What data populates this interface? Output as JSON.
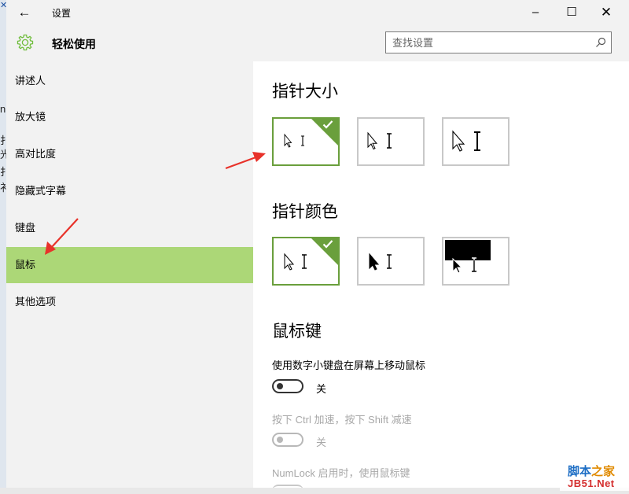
{
  "titlebar": {
    "back_icon": "arrow-left-icon",
    "title": "设置",
    "minimize_symbol": "–",
    "maximize_symbol": "☐",
    "close_symbol": "✕"
  },
  "header": {
    "icon": "gear-icon",
    "title": "轻松使用",
    "search_placeholder": "查找设置",
    "accent_color": "#6fbd3c"
  },
  "sidebar": {
    "items": [
      {
        "label": "讲述人"
      },
      {
        "label": "放大镜"
      },
      {
        "label": "高对比度"
      },
      {
        "label": "隐藏式字幕"
      },
      {
        "label": "键盘"
      },
      {
        "label": "鼠标",
        "selected": true
      },
      {
        "label": "其他选项"
      }
    ],
    "selected_color": "#acd777"
  },
  "content": {
    "pointer_size": {
      "title": "指针大小",
      "options": [
        {
          "name": "small",
          "selected": true
        },
        {
          "name": "medium",
          "selected": false
        },
        {
          "name": "large",
          "selected": false
        }
      ]
    },
    "pointer_color": {
      "title": "指针颜色",
      "options": [
        {
          "name": "white",
          "selected": true
        },
        {
          "name": "black",
          "selected": false
        },
        {
          "name": "inverted",
          "selected": false
        }
      ]
    },
    "mouse_keys": {
      "title": "鼠标键",
      "numpad_label": "使用数字小键盘在屏幕上移动鼠标",
      "numpad_state": "关",
      "ctrl_shift_label": "按下 Ctrl 加速，按下 Shift 减速",
      "ctrl_shift_state": "关",
      "numlock_label": "NumLock 启用时，使用鼠标键"
    },
    "selected_border_color": "#6a9f3c"
  },
  "background_glyphs": [
    "n",
    "扌",
    "光",
    "扌",
    "衤"
  ],
  "watermark": {
    "line1_part1": "脚本",
    "line1_part2": "之家",
    "line2": "JB51.Net"
  }
}
